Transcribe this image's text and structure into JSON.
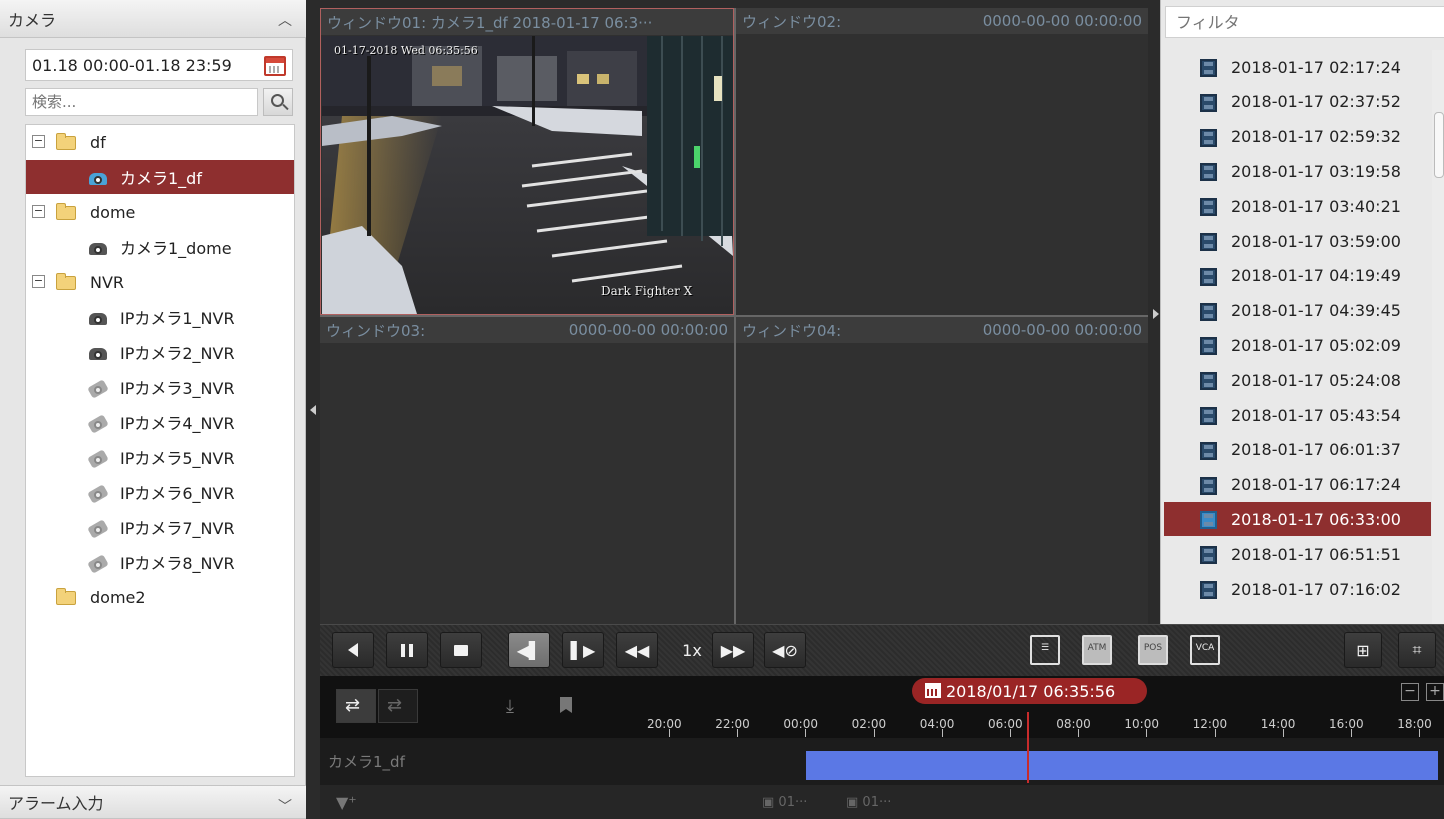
{
  "left_panel": {
    "camera_header": "カメラ",
    "date_range": "01.18 00:00-01.18 23:59",
    "search_placeholder": "検索...",
    "alarm_header": "アラーム入力",
    "tree": [
      {
        "label": "df",
        "type": "folder",
        "expanded": true,
        "icon": "folder-icon"
      },
      {
        "label": "カメラ1_df",
        "type": "camera",
        "selected": true,
        "icon": "camera-icon"
      },
      {
        "label": "dome",
        "type": "folder",
        "expanded": true,
        "icon": "folder-icon"
      },
      {
        "label": "カメラ1_dome",
        "type": "camera",
        "icon": "camera-icon"
      },
      {
        "label": "NVR",
        "type": "folder",
        "expanded": true,
        "icon": "folder-icon"
      },
      {
        "label": "IPカメラ1_NVR",
        "type": "camera",
        "icon": "camera-icon"
      },
      {
        "label": "IPカメラ2_NVR",
        "type": "camera",
        "icon": "camera-icon"
      },
      {
        "label": "IPカメラ3_NVR",
        "type": "ipcamera",
        "icon": "ip-camera-icon"
      },
      {
        "label": "IPカメラ4_NVR",
        "type": "ipcamera",
        "icon": "ip-camera-icon"
      },
      {
        "label": "IPカメラ5_NVR",
        "type": "ipcamera",
        "icon": "ip-camera-icon"
      },
      {
        "label": "IPカメラ6_NVR",
        "type": "ipcamera",
        "icon": "ip-camera-icon"
      },
      {
        "label": "IPカメラ7_NVR",
        "type": "ipcamera",
        "icon": "ip-camera-icon"
      },
      {
        "label": "IPカメラ8_NVR",
        "type": "ipcamera",
        "icon": "ip-camera-icon"
      },
      {
        "label": "dome2",
        "type": "folder",
        "expanded": false,
        "icon": "folder-icon"
      }
    ]
  },
  "windows": [
    {
      "title": "ウィンドウ01: カメラ1_df  2018-01-17 06:3···",
      "timestamp": ""
    },
    {
      "title": "ウィンドウ02:",
      "timestamp": "0000-00-00 00:00:00"
    },
    {
      "title": "ウィンドウ03:",
      "timestamp": "0000-00-00 00:00:00"
    },
    {
      "title": "ウィンドウ04:",
      "timestamp": "0000-00-00 00:00:00"
    }
  ],
  "video_osd": {
    "timestamp": "01-17-2018 Wed 06:35:56",
    "caption": "Dark Fighter X"
  },
  "right_panel": {
    "filter_placeholder": "フィルタ",
    "recordings": [
      "2018-01-17 02:17:24",
      "2018-01-17 02:37:52",
      "2018-01-17 02:59:32",
      "2018-01-17 03:19:58",
      "2018-01-17 03:40:21",
      "2018-01-17 03:59:00",
      "2018-01-17 04:19:49",
      "2018-01-17 04:39:45",
      "2018-01-17 05:02:09",
      "2018-01-17 05:24:08",
      "2018-01-17 05:43:54",
      "2018-01-17 06:01:37",
      "2018-01-17 06:17:24",
      "2018-01-17 06:33:00",
      "2018-01-17 06:51:51",
      "2018-01-17 07:16:02"
    ],
    "active_index": 13
  },
  "toolbar": {
    "speed": "1x",
    "icon_labels": {
      "atm": "ATM",
      "pos": "POS",
      "vca": "VCA"
    }
  },
  "timeline": {
    "current_datetime": "2018/01/17 06:35:56",
    "ticks": [
      "20:00",
      "22:00",
      "00:00",
      "02:00",
      "04:00",
      "06:00",
      "08:00",
      "10:00",
      "12:00",
      "14:00",
      "16:00",
      "18:00"
    ],
    "track_label": "カメラ1_df",
    "bottom_items": [
      "01···",
      "01···"
    ]
  },
  "colors": {
    "selection": "#8e2f2f",
    "recording_bar": "#5b78e5",
    "cursor": "#c82c2c"
  }
}
